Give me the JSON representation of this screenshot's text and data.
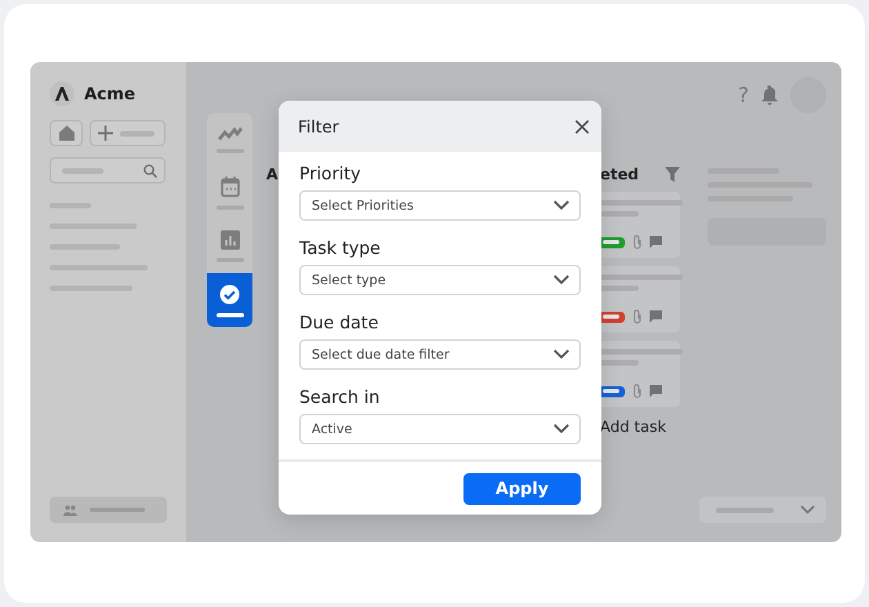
{
  "sidebar": {
    "brand": "Acme"
  },
  "rail": [
    {
      "kind": "trend",
      "selected": false
    },
    {
      "kind": "calendar",
      "selected": false
    },
    {
      "kind": "chart",
      "selected": false
    },
    {
      "kind": "check",
      "selected": true
    }
  ],
  "top_bar": {
    "help": "?"
  },
  "board": {
    "columns": [
      {
        "header": "A"
      },
      {
        "header": "eted",
        "cards": [
          {
            "color": "#1f9d2e"
          },
          {
            "color": "#d2402f"
          },
          {
            "color": "#1463d6"
          }
        ],
        "add_label": "Add task"
      }
    ]
  },
  "dialog": {
    "title": "Filter",
    "fields": [
      {
        "label": "Priority",
        "placeholder": "Select Priorities"
      },
      {
        "label": "Task type",
        "placeholder": "Select type"
      },
      {
        "label": "Due date",
        "placeholder": "Select due date filter"
      },
      {
        "label": "Search in",
        "value": "Active"
      }
    ],
    "apply": "Apply"
  }
}
